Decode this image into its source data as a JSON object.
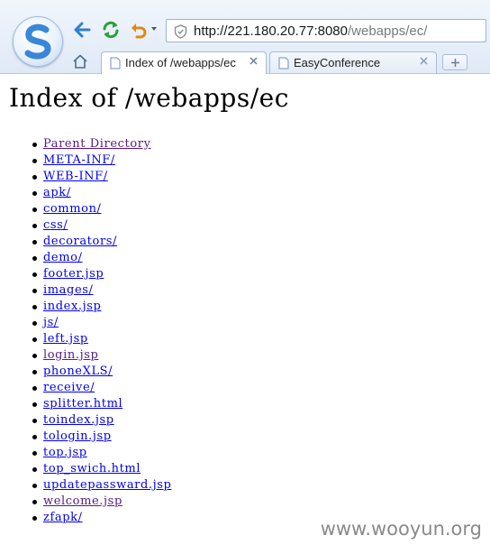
{
  "browser": {
    "address": {
      "host": "http://221.180.20.77:8080",
      "path": "/webapps/ec/"
    },
    "tabs": [
      {
        "label": "Index of /webapps/ec",
        "active": true
      },
      {
        "label": "EasyConference",
        "active": false
      }
    ],
    "icons": [
      "logo-icon",
      "back-arrow-icon",
      "refresh-icon",
      "undo-icon",
      "shield-icon",
      "home-icon",
      "page-icon",
      "close-icon",
      "plus-icon"
    ]
  },
  "page": {
    "title": "Index of /webapps/ec",
    "entries": [
      {
        "label": "Parent Directory",
        "visited": true
      },
      {
        "label": "META-INF/",
        "visited": false
      },
      {
        "label": "WEB-INF/",
        "visited": false
      },
      {
        "label": "apk/",
        "visited": false
      },
      {
        "label": "common/",
        "visited": false
      },
      {
        "label": "css/",
        "visited": false
      },
      {
        "label": "decorators/",
        "visited": false
      },
      {
        "label": "demo/",
        "visited": false
      },
      {
        "label": "footer.jsp",
        "visited": false
      },
      {
        "label": "images/",
        "visited": false
      },
      {
        "label": "index.jsp",
        "visited": false
      },
      {
        "label": "js/",
        "visited": false
      },
      {
        "label": "left.jsp",
        "visited": false
      },
      {
        "label": "login.jsp",
        "visited": true
      },
      {
        "label": "phoneXLS/",
        "visited": false
      },
      {
        "label": "receive/",
        "visited": false
      },
      {
        "label": "splitter.html",
        "visited": false
      },
      {
        "label": "toindex.jsp",
        "visited": false
      },
      {
        "label": "tologin.jsp",
        "visited": false
      },
      {
        "label": "top.jsp",
        "visited": false
      },
      {
        "label": "top_swich.html",
        "visited": false
      },
      {
        "label": "updatepassward.jsp",
        "visited": false
      },
      {
        "label": "welcome.jsp",
        "visited": true
      },
      {
        "label": "zfapk/",
        "visited": false
      }
    ]
  },
  "watermark": "www.wooyun.org",
  "colors": {
    "link": "#0000ee",
    "visited_link": "#551a8b",
    "chrome_accent": "#2f7fd0"
  }
}
